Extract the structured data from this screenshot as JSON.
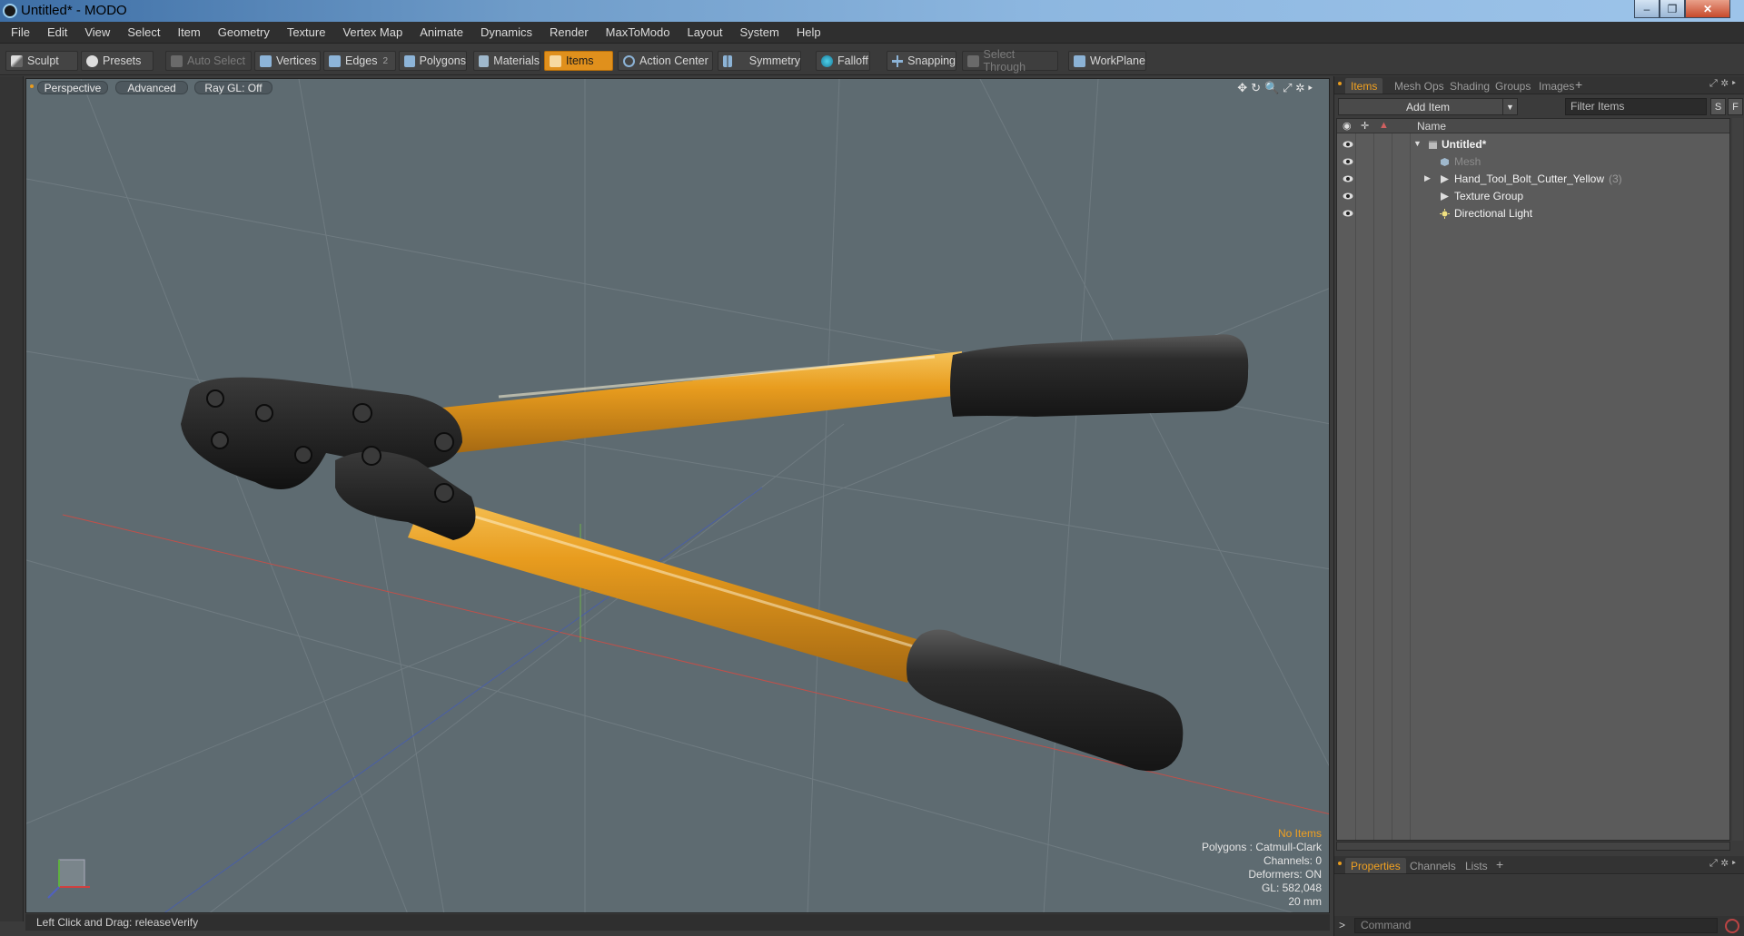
{
  "window": {
    "title": "Untitled* - MODO",
    "min": "‒",
    "max": "❐",
    "close": "✕"
  },
  "menu": [
    "File",
    "Edit",
    "View",
    "Select",
    "Item",
    "Geometry",
    "Texture",
    "Vertex Map",
    "Animate",
    "Dynamics",
    "Render",
    "MaxToModo",
    "Layout",
    "System",
    "Help"
  ],
  "toolbar": {
    "sculpt": "Sculpt",
    "presets": "Presets",
    "auto_select": "Auto Select",
    "vertices": "Vertices",
    "edges": "Edges",
    "edges_count": "2",
    "polygons": "Polygons",
    "materials": "Materials",
    "items": "Items",
    "action_center": "Action Center",
    "symmetry": "Symmetry",
    "falloff": "Falloff",
    "snapping": "Snapping",
    "select_through": "Select Through",
    "workplane": "WorkPlane"
  },
  "viewport": {
    "tabs": [
      "Perspective",
      "Advanced",
      "Ray GL: Off"
    ],
    "stats": {
      "items": "No Items",
      "polygons": "Polygons : Catmull-Clark",
      "channels": "Channels: 0",
      "deformers": "Deformers: ON",
      "gl": "GL: 582,048",
      "scale": "20 mm"
    },
    "colors": {
      "background": "#5e6b71",
      "handle": "#e89c1e",
      "jaw": "#1b1b1b",
      "grip": "#2c2c2c"
    }
  },
  "status": "Left Click and Drag:  releaseVerify",
  "right_panel": {
    "tabs": [
      "Items",
      "Mesh Ops",
      "Shading",
      "Groups",
      "Images"
    ],
    "add_item": "Add Item",
    "filter_placeholder": "Filter Items",
    "s_button": "S",
    "f_button": "F",
    "column_name": "Name",
    "tree": [
      {
        "label": "Untitled*",
        "type": "scene"
      },
      {
        "label": "Mesh",
        "type": "mesh"
      },
      {
        "label": "Hand_Tool_Bolt_Cutter_Yellow",
        "count": "(3)",
        "type": "group"
      },
      {
        "label": "Texture Group",
        "type": "group"
      },
      {
        "label": "Directional Light",
        "type": "light"
      }
    ],
    "bottom_tabs": [
      "Properties",
      "Channels",
      "Lists"
    ],
    "command_placeholder": "Command",
    "accent": "#f0a020"
  }
}
